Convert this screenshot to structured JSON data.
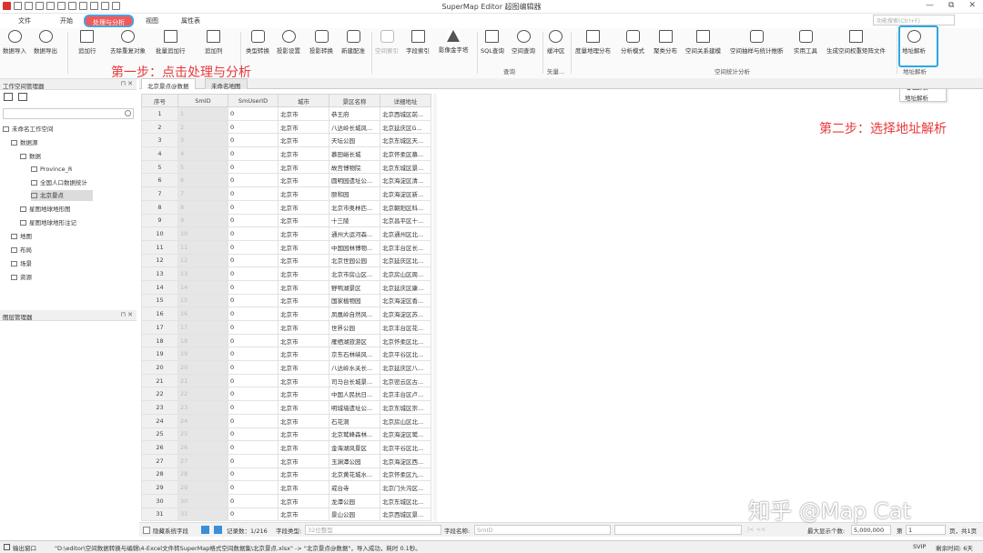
{
  "app": {
    "title": "SuperMap Editor 超图编辑器"
  },
  "window_controls": [
    "—",
    "⧉",
    "✕"
  ],
  "menu": {
    "file": "文件",
    "start": "开始",
    "process": "处理与分析",
    "view": "视图",
    "attributes": "属性表",
    "func_search_placeholder": "功能搜索(Ctrl+F)"
  },
  "ribbon": {
    "data_import": "数据导入",
    "data_export": "数据导出",
    "append_row": "追加行",
    "remove_dup": "去除重复对象",
    "batch_append_row": "批量追加行",
    "append_col": "追加列",
    "type_convert": "类型转换",
    "proj_settings": "投影设置",
    "proj_convert": "投影转换",
    "new_config": "新建配准",
    "spatial_index": "空间索引",
    "field_index": "字段索引",
    "image_pyramid": "影像金字塔",
    "sql_query": "SQL查询",
    "spatial_query": "空间查询",
    "buffer": "缓冲区",
    "density": "度量地理分布",
    "pattern": "分析模式",
    "cluster": "聚类分布",
    "relation": "空间关系建模",
    "sample": "空间抽样与统计推断",
    "tools": "实用工具",
    "weight_matrix": "生成空间权重矩阵文件",
    "address_parse": "地址解析",
    "group_query": "查询",
    "group_vector": "矢量...",
    "group_stats": "空间统计分析",
    "group_address": "地址解析"
  },
  "annotations": {
    "step1": "第一步：点击处理与分析",
    "step2": "第二步：选择地址解析"
  },
  "dropdown": {
    "item_bold": "地址解析",
    "item": "地址解析"
  },
  "workspace": {
    "title": "工作空间管理器",
    "pin": "⊓ ✕",
    "tree": [
      "未命名工作空间",
      "数据源",
      "数据",
      "Province_R",
      "全国人口数据统计",
      "北京景点",
      "星图地球地形图",
      "星图地球地形注记",
      "地图",
      "布局",
      "场景",
      "资源"
    ]
  },
  "layers": {
    "title": "图层管理器",
    "pin": "⊓ ✕"
  },
  "doc_tabs": [
    "北京景点@数据",
    "未命名地图"
  ],
  "table": {
    "headers": [
      "序号",
      "SmID",
      "SmUserID",
      "城市",
      "景区名称",
      "详细地址"
    ],
    "rows": [
      [
        "1",
        "1",
        "0",
        "北京市",
        "恭王府",
        "北京西城区前..."
      ],
      [
        "2",
        "2",
        "0",
        "北京市",
        "八达岭长城风...",
        "北京延庆区G..."
      ],
      [
        "3",
        "3",
        "0",
        "北京市",
        "天坛公园",
        "北京东城区天..."
      ],
      [
        "4",
        "4",
        "0",
        "北京市",
        "慕田峪长城",
        "北京怀柔区慕..."
      ],
      [
        "5",
        "5",
        "0",
        "北京市",
        "故宫博物院",
        "北京东城区景..."
      ],
      [
        "6",
        "6",
        "0",
        "北京市",
        "圆明园遗址公...",
        "北京海淀区清..."
      ],
      [
        "7",
        "7",
        "0",
        "北京市",
        "颐和园",
        "北京海淀区新..."
      ],
      [
        "8",
        "8",
        "0",
        "北京市",
        "北京市奥林匹...",
        "北京朝阳区科..."
      ],
      [
        "9",
        "9",
        "0",
        "北京市",
        "十三陵",
        "北京昌平区十..."
      ],
      [
        "10",
        "10",
        "0",
        "北京市",
        "通州大运河森...",
        "北京通州区北..."
      ],
      [
        "11",
        "11",
        "0",
        "北京市",
        "中国园林博物...",
        "北京丰台区长..."
      ],
      [
        "12",
        "12",
        "0",
        "北京市",
        "北京世园公园",
        "北京延庆区北..."
      ],
      [
        "13",
        "13",
        "0",
        "北京市",
        "北京市房山区...",
        "北京房山区周..."
      ],
      [
        "14",
        "14",
        "0",
        "北京市",
        "野鸭湖景区",
        "北京延庆区康..."
      ],
      [
        "15",
        "15",
        "0",
        "北京市",
        "国家植物园",
        "北京海淀区香..."
      ],
      [
        "16",
        "16",
        "0",
        "北京市",
        "凤凰岭自然风...",
        "北京海淀区苏..."
      ],
      [
        "17",
        "17",
        "0",
        "北京市",
        "世界公园",
        "北京丰台区花..."
      ],
      [
        "18",
        "18",
        "0",
        "北京市",
        "雁栖湖旅游区",
        "北京怀柔区北..."
      ],
      [
        "19",
        "19",
        "0",
        "北京市",
        "京东石林峡风...",
        "北京平谷区北..."
      ],
      [
        "20",
        "20",
        "0",
        "北京市",
        "八达岭水关长...",
        "北京延庆区八..."
      ],
      [
        "21",
        "21",
        "0",
        "北京市",
        "司马台长城景...",
        "北京密云区古..."
      ],
      [
        "22",
        "22",
        "0",
        "北京市",
        "中国人民抗日...",
        "北京丰台区卢..."
      ],
      [
        "23",
        "23",
        "0",
        "北京市",
        "明城墙遗址公...",
        "北京东城区崇..."
      ],
      [
        "24",
        "24",
        "0",
        "北京市",
        "石花洞",
        "北京房山区北..."
      ],
      [
        "25",
        "25",
        "0",
        "北京市",
        "北京鹫峰森林...",
        "北京海淀区鹫..."
      ],
      [
        "26",
        "26",
        "0",
        "北京市",
        "金海湖风景区",
        "北京平谷区北..."
      ],
      [
        "27",
        "27",
        "0",
        "北京市",
        "玉渊潭公园",
        "北京海淀区西..."
      ],
      [
        "28",
        "28",
        "0",
        "北京市",
        "北京黄花城水...",
        "北京怀柔区九..."
      ],
      [
        "29",
        "29",
        "0",
        "北京市",
        "戒台寺",
        "北京门头沟区..."
      ],
      [
        "30",
        "30",
        "0",
        "北京市",
        "龙潭公园",
        "北京东城区北..."
      ],
      [
        "31",
        "31",
        "0",
        "北京市",
        "景山公园",
        "北京西城区景..."
      ]
    ]
  },
  "status": {
    "hide_sys_fields": "隐藏系统字段",
    "record_count": "记录数：1/216",
    "field_type": "字段类型:",
    "field_type_value": "32位整型",
    "field_name": "字段名称:",
    "field_name_value": "SmID",
    "max_display": "最大显示个数:",
    "max_display_value": "5,000,000",
    "page_prefix": "第",
    "page_value": "1",
    "page_suffix": "页，共1页"
  },
  "bottom": {
    "output_window": "输出窗口",
    "log": "\"D:\\editor\\空间数据转换与编辑\\4-Excel文件转SuperMap格式空间数据集\\北京景点.xlsx\"    -> \"北京景点@数据\"，导入成功，耗时 0.1秒。",
    "svip": "SVIP",
    "remaining": "剩余时间: 6天"
  },
  "watermark": "知乎 @Map Cat"
}
